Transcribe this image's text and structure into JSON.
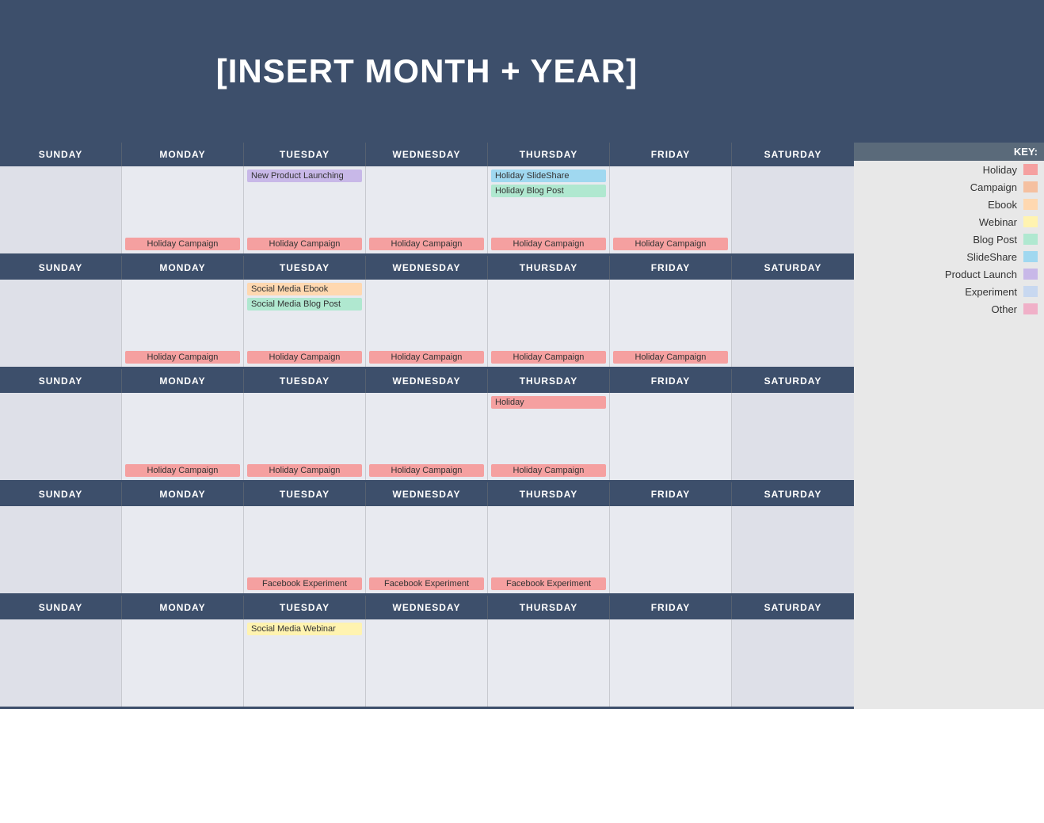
{
  "header": {
    "title": "[INSERT MONTH + YEAR]"
  },
  "key": {
    "title": "KEY:",
    "items": [
      {
        "label": "Holiday",
        "color": "#f5a0a0"
      },
      {
        "label": "Campaign",
        "color": "#f5c0a0"
      },
      {
        "label": "Ebook",
        "color": "#ffd8b0"
      },
      {
        "label": "Webinar",
        "color": "#fff3b0"
      },
      {
        "label": "Blog Post",
        "color": "#b0e8d0"
      },
      {
        "label": "SlideShare",
        "color": "#a0d8f0"
      },
      {
        "label": "Product Launch",
        "color": "#c8b8e8"
      },
      {
        "label": "Experiment",
        "color": "#c8d8f0"
      },
      {
        "label": "Other",
        "color": "#f0b0c8"
      }
    ]
  },
  "days": {
    "headers": [
      "SUNDAY",
      "MONDAY",
      "TUESDAY",
      "WEDNESDAY",
      "THURSDAY",
      "FRIDAY",
      "SATURDAY"
    ]
  },
  "weeks": [
    {
      "id": "week1",
      "cells": [
        {
          "day": "sunday",
          "events": [],
          "footer": ""
        },
        {
          "day": "monday",
          "events": [],
          "footer": "Holiday Campaign"
        },
        {
          "day": "tuesday",
          "events": [
            "New Product Launching"
          ],
          "event_types": [
            "productlaunch"
          ],
          "footer": "Holiday Campaign"
        },
        {
          "day": "wednesday",
          "events": [],
          "footer": "Holiday Campaign"
        },
        {
          "day": "thursday",
          "events": [
            "Holiday SlideShare",
            "Holiday Blog Post"
          ],
          "event_types": [
            "slideshare",
            "blogpost"
          ],
          "footer": "Holiday Campaign"
        },
        {
          "day": "friday",
          "events": [],
          "footer": "Holiday Campaign"
        },
        {
          "day": "saturday",
          "events": [],
          "footer": ""
        }
      ]
    },
    {
      "id": "week2",
      "cells": [
        {
          "day": "sunday",
          "events": [],
          "footer": ""
        },
        {
          "day": "monday",
          "events": [],
          "footer": "Holiday Campaign"
        },
        {
          "day": "tuesday",
          "events": [
            "Social Media Ebook",
            "Social Media Blog Post"
          ],
          "event_types": [
            "ebook",
            "blogpost"
          ],
          "footer": "Holiday Campaign"
        },
        {
          "day": "wednesday",
          "events": [],
          "footer": "Holiday Campaign"
        },
        {
          "day": "thursday",
          "events": [],
          "footer": "Holiday Campaign"
        },
        {
          "day": "friday",
          "events": [],
          "footer": "Holiday Campaign"
        },
        {
          "day": "saturday",
          "events": [],
          "footer": ""
        }
      ]
    },
    {
      "id": "week3",
      "cells": [
        {
          "day": "sunday",
          "events": [],
          "footer": ""
        },
        {
          "day": "monday",
          "events": [],
          "footer": "Holiday Campaign"
        },
        {
          "day": "tuesday",
          "events": [],
          "footer": "Holiday Campaign"
        },
        {
          "day": "wednesday",
          "events": [],
          "footer": "Holiday Campaign"
        },
        {
          "day": "thursday",
          "events": [
            "Holiday"
          ],
          "event_types": [
            "holiday"
          ],
          "footer": "Holiday Campaign"
        },
        {
          "day": "friday",
          "events": [],
          "footer": ""
        },
        {
          "day": "saturday",
          "events": [],
          "footer": ""
        }
      ]
    },
    {
      "id": "week4",
      "cells": [
        {
          "day": "sunday",
          "events": [],
          "footer": ""
        },
        {
          "day": "monday",
          "events": [],
          "footer": ""
        },
        {
          "day": "tuesday",
          "events": [],
          "footer": "Facebook Experiment"
        },
        {
          "day": "wednesday",
          "events": [],
          "footer": "Facebook Experiment"
        },
        {
          "day": "thursday",
          "events": [],
          "footer": "Facebook Experiment"
        },
        {
          "day": "friday",
          "events": [],
          "footer": ""
        },
        {
          "day": "saturday",
          "events": [],
          "footer": ""
        }
      ]
    },
    {
      "id": "week5",
      "cells": [
        {
          "day": "sunday",
          "events": [],
          "footer": ""
        },
        {
          "day": "monday",
          "events": [],
          "footer": ""
        },
        {
          "day": "tuesday",
          "events": [
            "Social Media Webinar"
          ],
          "event_types": [
            "webinar"
          ],
          "footer": ""
        },
        {
          "day": "wednesday",
          "events": [],
          "footer": ""
        },
        {
          "day": "thursday",
          "events": [],
          "footer": ""
        },
        {
          "day": "friday",
          "events": [],
          "footer": ""
        },
        {
          "day": "saturday",
          "events": [],
          "footer": ""
        }
      ]
    }
  ]
}
